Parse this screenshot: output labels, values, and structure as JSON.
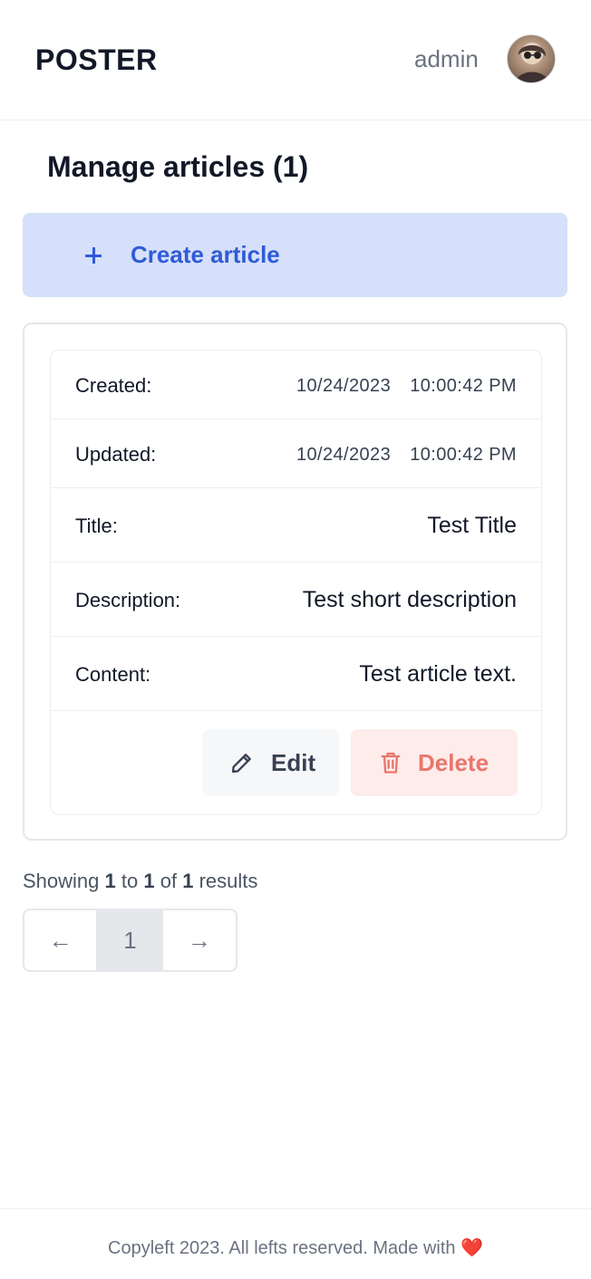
{
  "header": {
    "brand": "POSTER",
    "username": "admin",
    "avatar_alt": "user-avatar"
  },
  "main": {
    "title": "Manage articles (1)",
    "create_button": "Create article"
  },
  "article": {
    "created_label": "Created:",
    "created_date": "10/24/2023",
    "created_time": "10:00:42 PM",
    "updated_label": "Updated:",
    "updated_date": "10/24/2023",
    "updated_time": "10:00:42 PM",
    "title_label": "Title:",
    "title_value": "Test Title",
    "description_label": "Description:",
    "description_value": "Test short description",
    "content_label": "Content:",
    "content_value": "Test article text.",
    "edit_label": "Edit",
    "delete_label": "Delete"
  },
  "pagination": {
    "showing_prefix": "Showing",
    "from": "1",
    "to_word": "to",
    "to": "1",
    "of_word": "of",
    "total": "1",
    "results_word": "results",
    "current_page": "1",
    "prev_arrow": "←",
    "next_arrow": "→"
  },
  "footer": {
    "text": "Copyleft 2023. All lefts reserved. Made with",
    "heart": "❤️"
  },
  "colors": {
    "accent": "#2f5bd8",
    "accent_bg": "#d6e0fa",
    "danger": "#e8766c",
    "danger_bg": "#fdecea"
  }
}
